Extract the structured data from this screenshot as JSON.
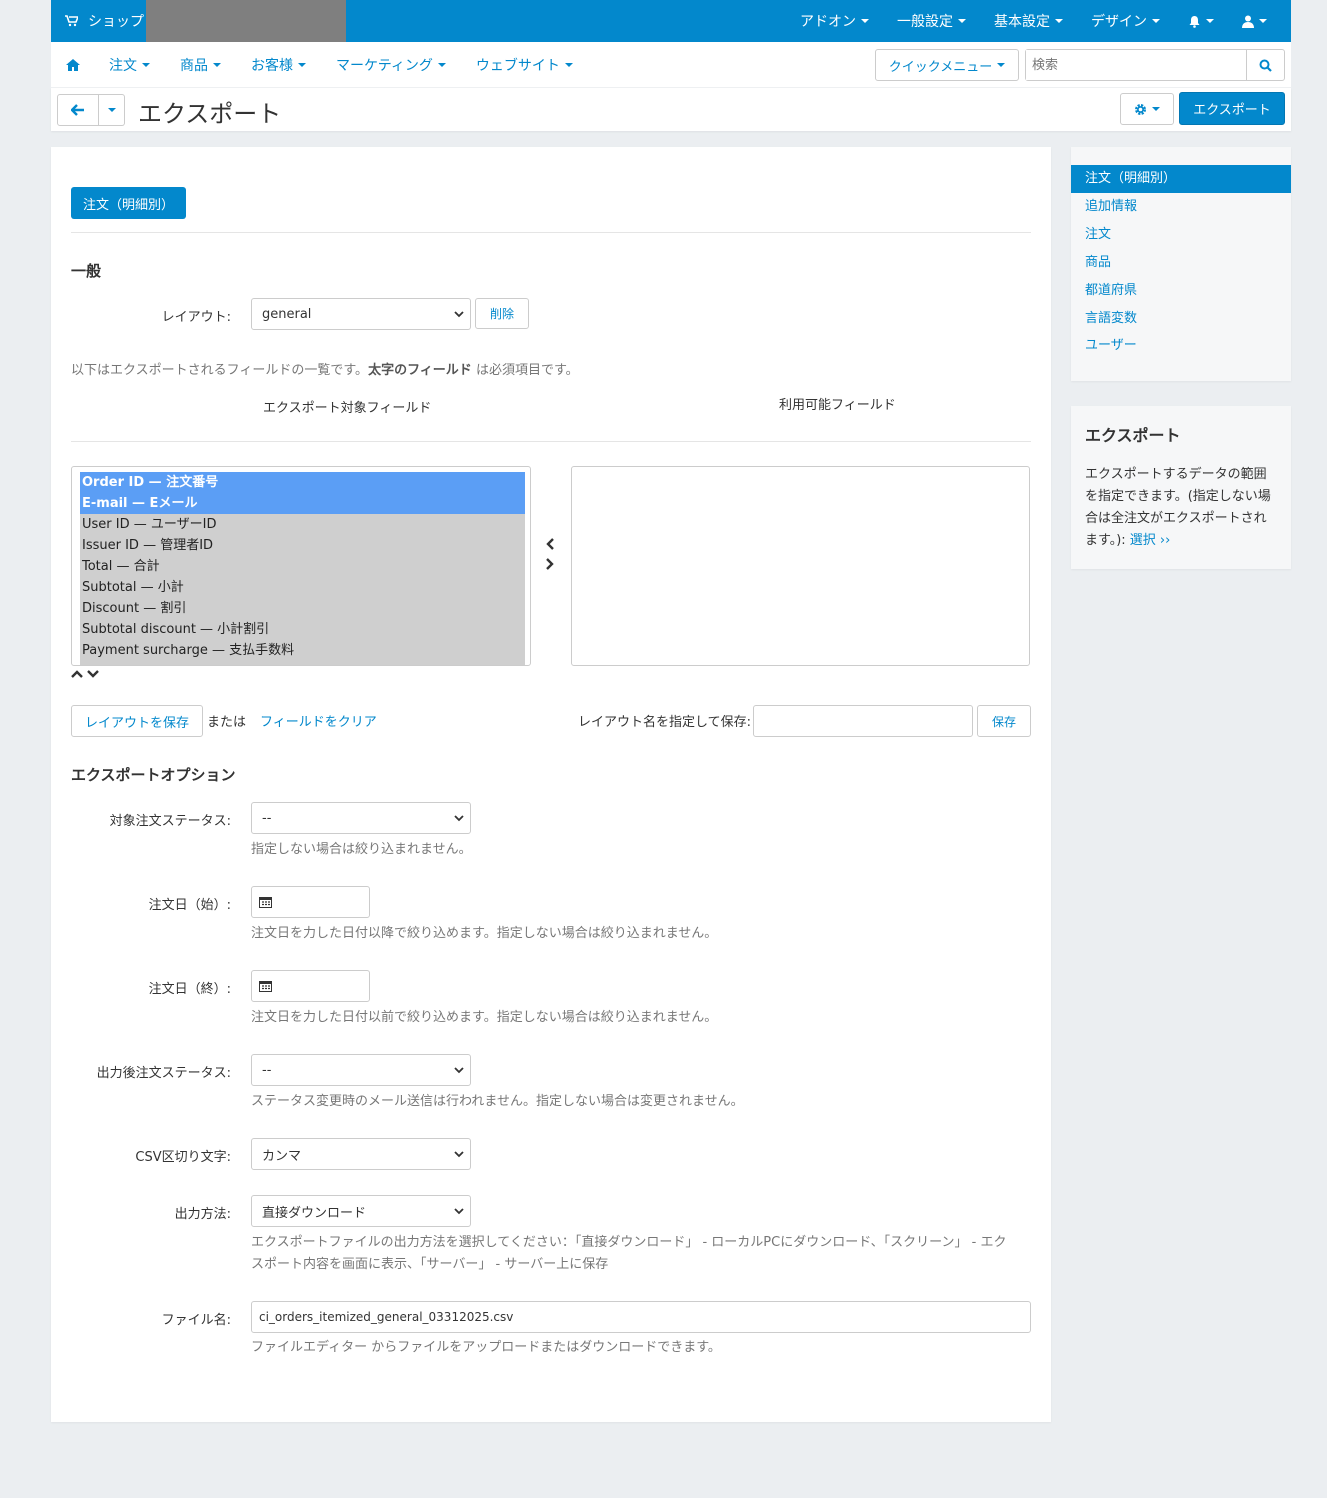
{
  "topbar": {
    "shop_label": "ショップ",
    "menu": [
      "アドオン",
      "一般設定",
      "基本設定",
      "デザイン"
    ]
  },
  "navbar": {
    "menu": [
      "注文",
      "商品",
      "お客様",
      "マーケティング",
      "ウェブサイト"
    ],
    "quick_menu": "クイックメニュー",
    "search_placeholder": "検索"
  },
  "titlebar": {
    "title": "エクスポート",
    "export_button": "エクスポート"
  },
  "main": {
    "tab": "注文（明細別）",
    "general_heading": "一般",
    "layout_label": "レイアウト:",
    "layout_value": "general",
    "delete_button": "削除",
    "fields_note_prefix": "以下はエクスポートされるフィールドの一覧です。",
    "fields_note_bold": "太字のフィールド",
    "fields_note_suffix": " は必須項目です。",
    "export_fields_title": "エクスポート対象フィールド",
    "available_fields_title": "利用可能フィールド",
    "export_fields": [
      {
        "label": "Order ID — 注文番号",
        "selected": true
      },
      {
        "label": "E-mail — Eメール",
        "selected": true
      },
      {
        "label": "User ID — ユーザーID",
        "selected": false
      },
      {
        "label": "Issuer ID — 管理者ID",
        "selected": false
      },
      {
        "label": "Total — 合計",
        "selected": false
      },
      {
        "label": "Subtotal — 小計",
        "selected": false
      },
      {
        "label": "Discount — 割引",
        "selected": false
      },
      {
        "label": "Subtotal discount — 小計割引",
        "selected": false
      },
      {
        "label": "Payment surcharge — 支払手数料",
        "selected": false
      }
    ],
    "save_layout_button": "レイアウトを保存",
    "or_text": "または",
    "clear_fields_link": "フィールドをクリア",
    "save_as_label": "レイアウト名を指定して保存:",
    "save_button": "保存",
    "options_heading": "エクスポートオプション",
    "options": {
      "status_label": "対象注文ステータス:",
      "status_value": "--",
      "status_help": "指定しない場合は絞り込まれません。",
      "date_from_label": "注文日（始）:",
      "date_from_help": "注文日を力した日付以降で絞り込めます。指定しない場合は絞り込まれません。",
      "date_to_label": "注文日（終）:",
      "date_to_help": "注文日を力した日付以前で絞り込めます。指定しない場合は絞り込まれません。",
      "after_status_label": "出力後注文ステータス:",
      "after_status_value": "--",
      "after_status_help": "ステータス変更時のメール送信は行われません。指定しない場合は変更されません。",
      "delimiter_label": "CSV区切り文字:",
      "delimiter_value": "カンマ",
      "output_label": "出力方法:",
      "output_value": "直接ダウンロード",
      "output_help_1": "エクスポートファイルの出力方法を選択してください：「直接ダウンロード」 - ローカルPCにダウンロード、「スクリーン」 - エク",
      "output_help_2": "スポート内容を画面に表示、「サーバー」 - サーバー上に保存",
      "filename_label": "ファイル名:",
      "filename_value": "ci_orders_itemized_general_03312025.csv",
      "filename_help": "ファイルエディター からファイルをアップロードまたはダウンロードできます。"
    }
  },
  "sidebar": {
    "items": [
      "注文（明細別）",
      "追加情報",
      "注文",
      "商品",
      "都道府県",
      "言語変数",
      "ユーザー"
    ],
    "info_title": "エクスポート",
    "info_text": "エクスポートするデータの範囲を指定できます。(指定しない場合は全注文がエクスポートされます。):",
    "info_link": "選択 ››"
  },
  "colors": {
    "primary": "#0388cc",
    "selected_option": "#5b9ef5",
    "list_background": "#cfcfcf",
    "page_background": "#ebeef1"
  }
}
